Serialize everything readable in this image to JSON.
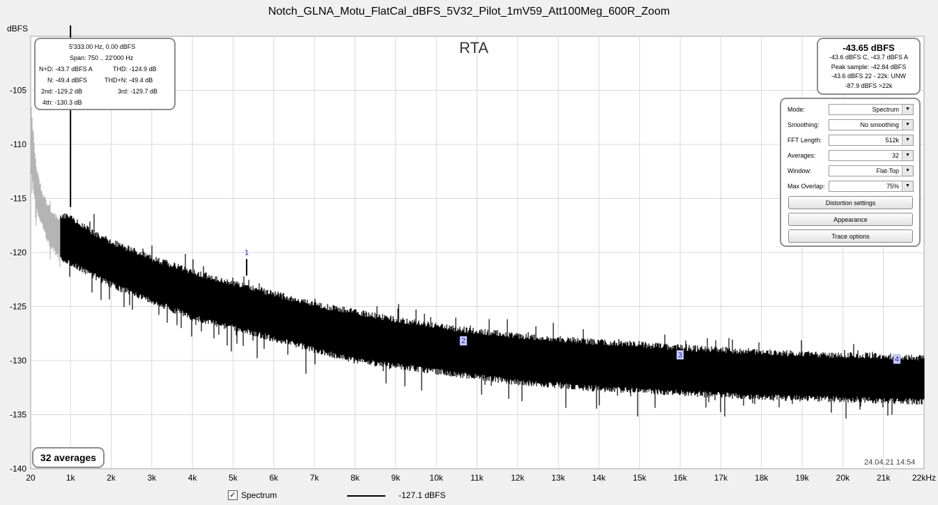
{
  "title": "Notch_GLNA_Motu_FlatCal_dBFS_5V32_Pilot_1mV59_Att100Meg_600R_Zoom",
  "rta_label": "RTA",
  "distortion_box": {
    "fundamental": "5'333.00 Hz, 0.00 dBFS",
    "span": "Span: 750 .. 22'000 Hz",
    "nd": "N+D: -43.7 dBFS A",
    "thd": "THD: -124.9 dB",
    "n": "N: -49.4 dBFS",
    "thdn": "THD+N: -49.4 dB",
    "h2": "2nd: -129.2 dB",
    "h3": "3rd: -129.7 dB",
    "h4": "4th: -130.3 dB"
  },
  "level_box": {
    "main": "-43.65 dBFS",
    "line1": "-43.6 dBFS C, -43.7 dBFS A",
    "line2": "Peak sample: -42.84 dBFS",
    "line3": "-43.6 dBFS 22 - 22k: UNW",
    "line4": "-87.9 dBFS >22k"
  },
  "controls": {
    "mode_label": "Mode:",
    "mode_value": "Spectrum",
    "smoothing_label": "Smoothing:",
    "smoothing_value": "No  smoothing",
    "fft_label": "FFT Length:",
    "fft_value": "512k",
    "averages_label": "Averages:",
    "averages_value": "32",
    "window_label": "Window:",
    "window_value": "Flat-Top",
    "overlap_label": "Max Overlap:",
    "overlap_value": "75%",
    "distortion_button": "Distortion settings",
    "appearance_button": "Appearance",
    "trace_button": "Trace options",
    "dropdown_icon": "chevron-down-icon"
  },
  "averages_badge": "32 averages",
  "timestamp": "24.04.21 14:54",
  "legend": {
    "checked": true,
    "name": "Spectrum",
    "value": "-127.1 dBFS",
    "color": "#000000"
  },
  "colors": {
    "trace": "#000000",
    "below_span_trace": "#b4b4b4",
    "marker": "#1a1aa8",
    "marker_bg": "#c8d0ff",
    "grid": "#d8d8d8"
  },
  "chart_data": {
    "type": "line",
    "title": "Notch_GLNA_Motu_FlatCal_dBFS_5V32_Pilot_1mV59_Att100Meg_600R_Zoom",
    "ylabel": "dBFS",
    "xlabel": "",
    "xlim": [
      20,
      22000
    ],
    "ylim": [
      -140,
      -100
    ],
    "x_tick_labels": [
      "20",
      "1k",
      "2k",
      "3k",
      "4k",
      "5k",
      "6k",
      "7k",
      "8k",
      "9k",
      "10k",
      "11k",
      "12k",
      "13k",
      "14k",
      "15k",
      "16k",
      "17k",
      "18k",
      "19k",
      "20k",
      "21k",
      "22kHz"
    ],
    "x_tick_values": [
      20,
      1000,
      2000,
      3000,
      4000,
      5000,
      6000,
      7000,
      8000,
      9000,
      10000,
      11000,
      12000,
      13000,
      14000,
      15000,
      16000,
      17000,
      18000,
      19000,
      20000,
      21000,
      22000
    ],
    "y_tick_values": [
      -105,
      -110,
      -115,
      -120,
      -125,
      -130,
      -135,
      -140
    ],
    "y_tick_labels": [
      "-105",
      "-110",
      "-115",
      "-120",
      "-125",
      "-130",
      "-135",
      "-140"
    ],
    "grid": true,
    "series": [
      {
        "name": "Spectrum",
        "envelope_x": [
          750,
          1000,
          1500,
          2000,
          3000,
          4000,
          5000,
          6000,
          7000,
          8000,
          9000,
          10000,
          11000,
          12000,
          13000,
          14000,
          15000,
          16000,
          17000,
          18000,
          19000,
          20000,
          21000,
          22000
        ],
        "envelope_upper": [
          -116.5,
          -116.8,
          -118.0,
          -119.0,
          -120.5,
          -121.8,
          -122.8,
          -123.8,
          -124.8,
          -125.5,
          -126.2,
          -126.8,
          -127.3,
          -127.7,
          -128.0,
          -128.3,
          -128.5,
          -128.8,
          -129.0,
          -129.2,
          -129.4,
          -129.5,
          -129.6,
          -129.7
        ],
        "envelope_lower": [
          -120.5,
          -121.0,
          -122.0,
          -123.0,
          -124.5,
          -126.0,
          -127.0,
          -128.0,
          -129.0,
          -130.0,
          -130.5,
          -131.0,
          -131.5,
          -132.0,
          -132.3,
          -132.6,
          -132.8,
          -133.0,
          -133.2,
          -133.4,
          -133.5,
          -133.6,
          -133.7,
          -133.8
        ],
        "peaks": [
          {
            "x": 1000,
            "y": -99
          },
          {
            "x": 5333,
            "y": -120.6
          }
        ]
      }
    ],
    "below_span_trace": {
      "x": [
        20,
        150,
        300,
        500,
        750
      ],
      "upper": [
        -106,
        -112,
        -114.5,
        -116,
        -117
      ],
      "lower": [
        -112,
        -116,
        -117.5,
        -119.5,
        -120.5
      ]
    },
    "harmonic_markers": [
      {
        "label": "1",
        "x": 5333,
        "y": -120.6
      },
      {
        "label": "2",
        "x": 10666,
        "y": -128.2
      },
      {
        "label": "3",
        "x": 15999,
        "y": -129.5
      },
      {
        "label": "4",
        "x": 21332,
        "y": -129.9
      }
    ]
  }
}
